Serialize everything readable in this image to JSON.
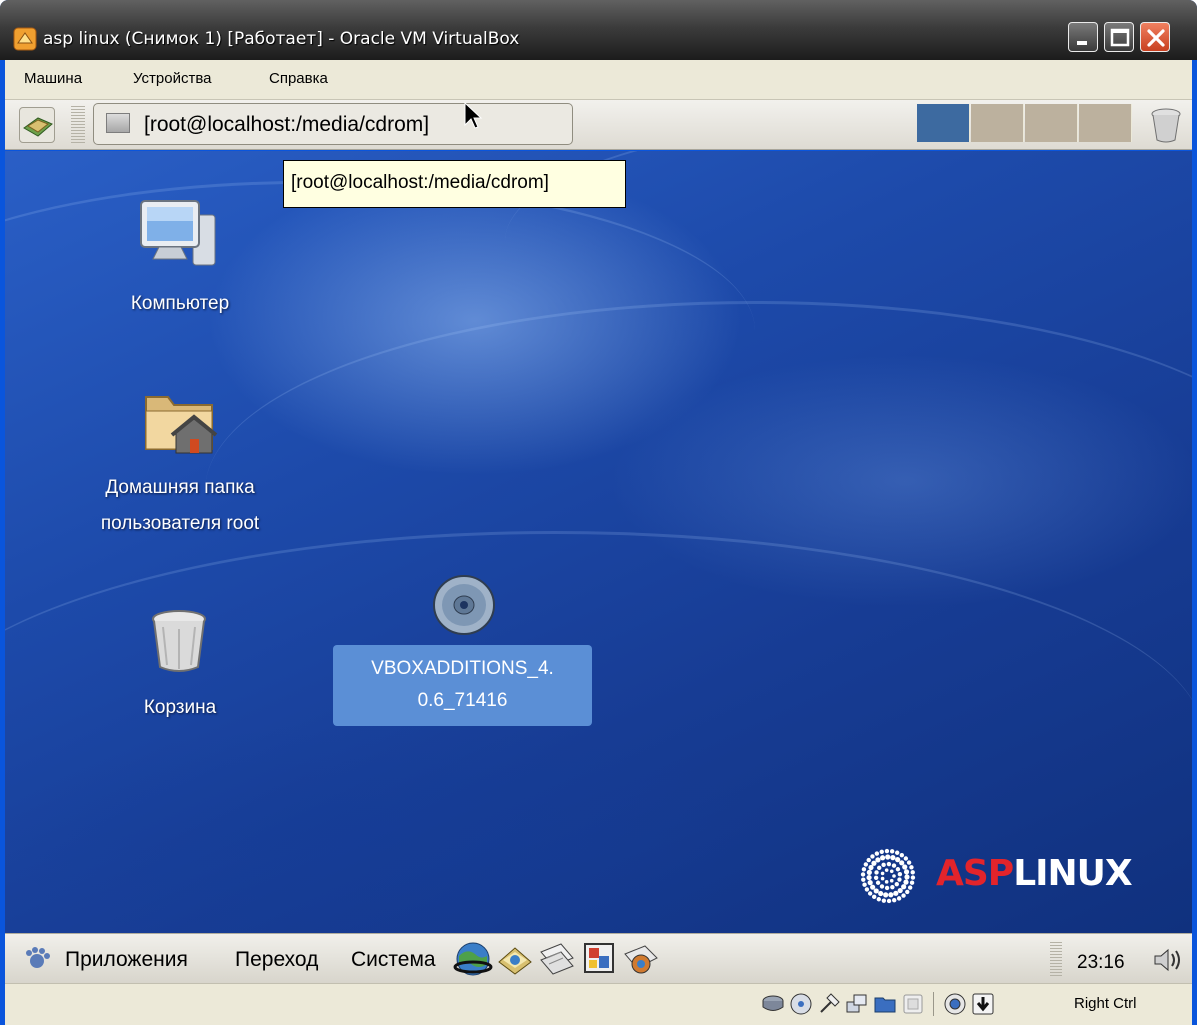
{
  "window": {
    "title": "asp linux (Снимок 1) [Работает] - Oracle VM VirtualBox",
    "controls": [
      "minimize",
      "maximize",
      "close"
    ]
  },
  "menubar": {
    "items": [
      "Машина",
      "Устройства",
      "Справка"
    ]
  },
  "top_panel": {
    "task_button_label": "[root@localhost:/media/cdrom]",
    "tooltip": "[root@localhost:/media/cdrom]",
    "workspaces": {
      "count": 4,
      "active_index": 0,
      "active_color": "#3d6aa0",
      "inactive_color": "#bcb19e"
    }
  },
  "desktop": {
    "icons": [
      {
        "label": "Компьютер",
        "icon": "computer-icon"
      },
      {
        "label_line1": "Домашняя папка",
        "label_line2": "пользователя root",
        "icon": "home-folder-icon"
      },
      {
        "label": "Корзина",
        "icon": "trash-icon"
      },
      {
        "label_line1": "VBOXADDITIONS_4.",
        "label_line2": "0.6_71416",
        "icon": "cdrom-icon",
        "selected": true
      }
    ],
    "logo": {
      "part1": "ASP",
      "part2": "LINUX",
      "part1_color": "#e3242b",
      "part2_color": "#ffffff"
    }
  },
  "bottom_panel": {
    "menus": [
      "Приложения",
      "Переход",
      "Система"
    ],
    "launchers": [
      "web-browser-icon",
      "email-icon",
      "office-icon",
      "presentation-icon",
      "graphics-icon"
    ],
    "clock": "23:16"
  },
  "statusbar": {
    "icons": [
      "hard-disk-icon",
      "optical-drive-icon",
      "usb-icon",
      "network-icon",
      "shared-folders-icon",
      "display-icon",
      "capture-icon",
      "keyboard-capture-icon"
    ],
    "host_key": "Right Ctrl"
  }
}
